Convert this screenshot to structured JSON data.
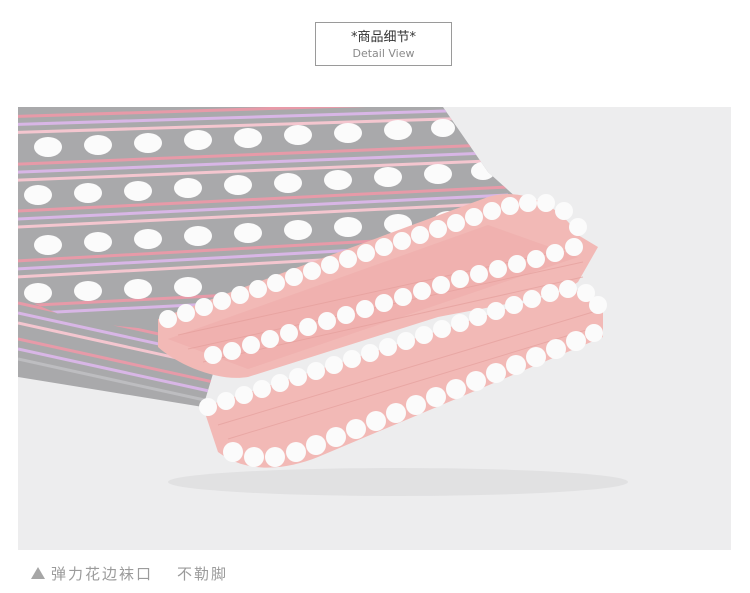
{
  "header": {
    "title": "*商品细节*",
    "subtitle": "Detail View"
  },
  "photo": {
    "icon": "product-detail-photo",
    "colors": {
      "background": "#ededee",
      "grey_knit": "#a9a9ab",
      "pink_cuff": "#f2b9b6",
      "white_scallop": "#fbfbfb",
      "stripe_pink": "#e79aa8",
      "stripe_lilac": "#d8b6e6"
    }
  },
  "caption": {
    "icon": "triangle-up-icon",
    "feature": "弹力花边袜口",
    "benefit": "不勒脚"
  }
}
